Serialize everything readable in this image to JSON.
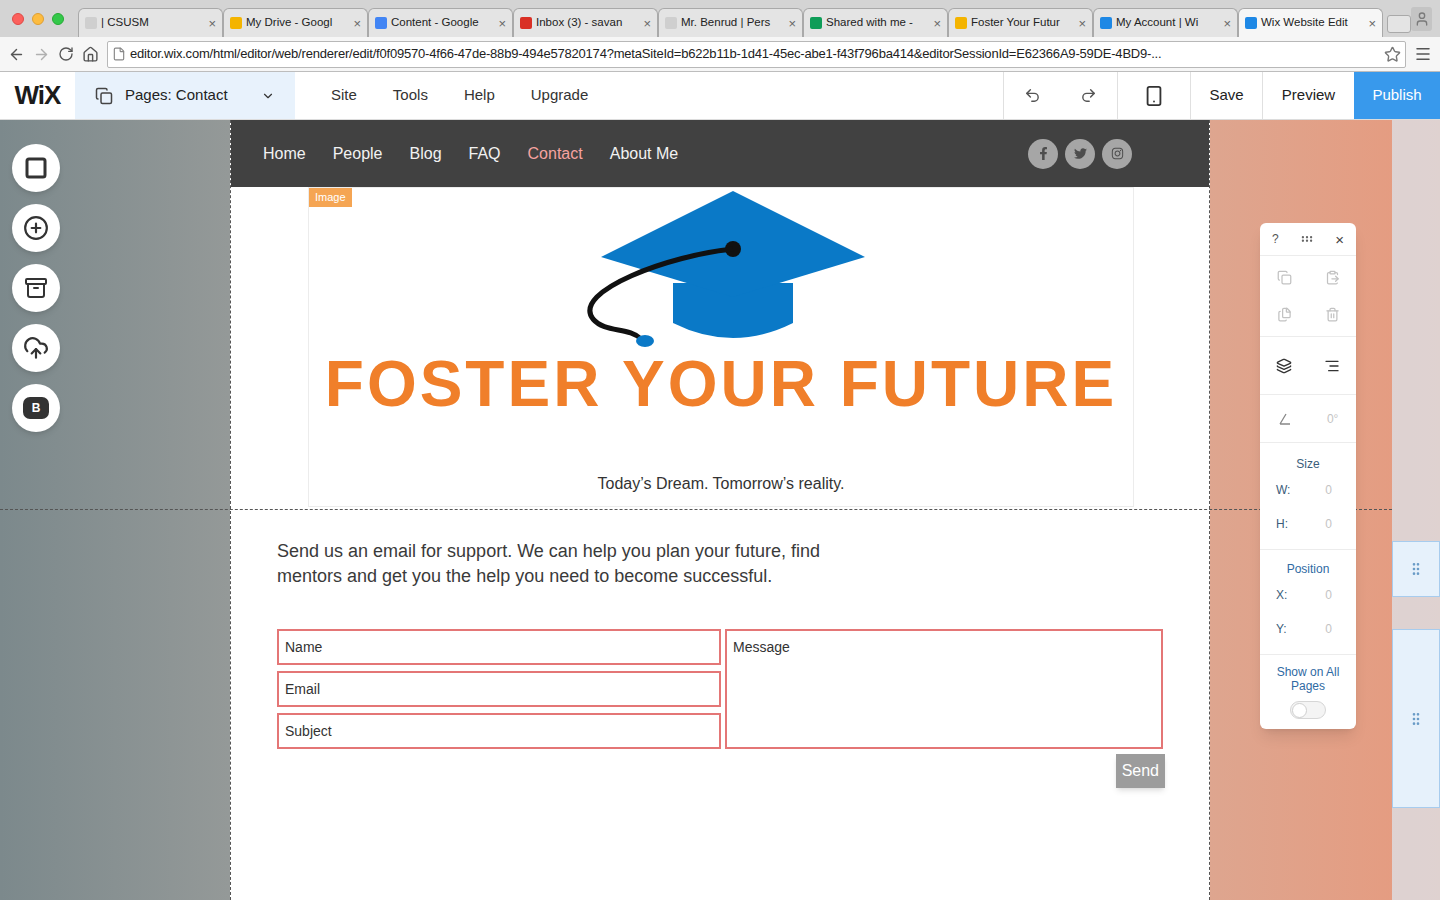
{
  "browser": {
    "tabs": [
      {
        "label": "| CSUSM",
        "selected": false,
        "color": "#cfcfcf"
      },
      {
        "label": "My Drive - Googl",
        "selected": false,
        "color": "#f4b400"
      },
      {
        "label": "Content - Google",
        "selected": false,
        "color": "#4285f4"
      },
      {
        "label": "Inbox (3) - savan",
        "selected": false,
        "color": "#d93025"
      },
      {
        "label": "Mr. Benrud | Pers",
        "selected": false,
        "color": "#cfcfcf"
      },
      {
        "label": "Shared with me -",
        "selected": false,
        "color": "#0f9d58"
      },
      {
        "label": "Foster Your Futur",
        "selected": false,
        "color": "#f4b400"
      },
      {
        "label": "My Account | Wi",
        "selected": false,
        "color": "#1e88e5"
      },
      {
        "label": "Wix Website Edit",
        "selected": true,
        "color": "#1e88e5"
      }
    ],
    "tab_close": "×",
    "url": "editor.wix.com/html/editor/web/renderer/edit/f0f09570-4f66-47de-88b9-494e57820174?metaSiteId=b622b11b-1d41-45ec-abe1-f43f796ba414&editorSessionId=E62366A9-59DE-4BD9-..."
  },
  "editor": {
    "logo": "WiX",
    "pages_label": "Pages: Contact",
    "menu": [
      "Site",
      "Tools",
      "Help",
      "Upgrade"
    ],
    "save": "Save",
    "preview": "Preview",
    "publish": "Publish",
    "blog_badge": "B"
  },
  "site": {
    "nav": [
      {
        "label": "Home",
        "selected": false
      },
      {
        "label": "People",
        "selected": false
      },
      {
        "label": "Blog",
        "selected": false
      },
      {
        "label": "FAQ",
        "selected": false
      },
      {
        "label": "Contact",
        "selected": true
      },
      {
        "label": "About Me",
        "selected": false
      }
    ],
    "image_tag": "Image",
    "logo_title": "FOSTER YOUR FUTURE",
    "tagline": "Today’s Dream. Tomorrow’s reality.",
    "intro": "Send us an email for support. We can help you plan your future, find mentors and get you the help you need to become successful.",
    "form": {
      "fields": [
        "Name",
        "Email",
        "Subject"
      ],
      "message": "Message",
      "send": "Send"
    }
  },
  "panel": {
    "help": "?",
    "close": "×",
    "rotation": "0°",
    "size_title": "Size",
    "size": [
      {
        "label": "W:",
        "value": "0",
        "disabled": true
      },
      {
        "label": "H:",
        "value": "0",
        "disabled": true
      }
    ],
    "position_title": "Position",
    "position": [
      {
        "label": "X:",
        "value": "0",
        "disabled": true
      },
      {
        "label": "Y:",
        "value": "0",
        "disabled": true
      }
    ],
    "show_on_all_pages": {
      "label": "Show on All Pages",
      "on": false
    }
  }
}
